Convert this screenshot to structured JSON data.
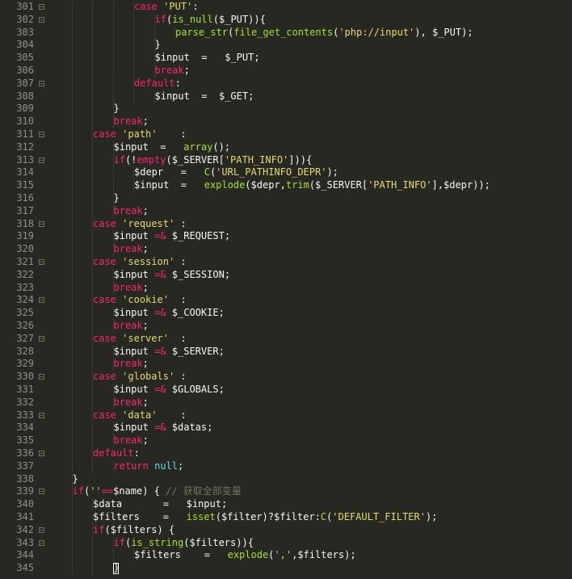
{
  "colors": {
    "background": "#272822",
    "line_number": "#8f908a",
    "keyword": "#f92672",
    "string": "#e6db74",
    "function": "#a6e22e",
    "text": "#f8f8f2",
    "comment": "#75715e",
    "constant": "#66d9ef"
  },
  "lines": [
    {
      "num": "301",
      "indent": 4,
      "fold": true,
      "tokens": [
        [
          "kw",
          "case"
        ],
        [
          "txt",
          " "
        ],
        [
          "str",
          "'PUT'"
        ],
        [
          "txt",
          ":"
        ]
      ]
    },
    {
      "num": "302",
      "indent": 5,
      "fold": true,
      "tokens": [
        [
          "kw",
          "if"
        ],
        [
          "txt",
          "("
        ],
        [
          "fn",
          "is_null"
        ],
        [
          "txt",
          "("
        ],
        [
          "var",
          "$_PUT"
        ],
        [
          "txt",
          "))"
        ],
        [
          "txt",
          "{"
        ]
      ]
    },
    {
      "num": "303",
      "indent": 6,
      "fold": false,
      "tokens": [
        [
          "fn",
          "parse_str"
        ],
        [
          "txt",
          "("
        ],
        [
          "fn",
          "file_get_contents"
        ],
        [
          "txt",
          "("
        ],
        [
          "str",
          "'php://input'"
        ],
        [
          "txt",
          "), "
        ],
        [
          "var",
          "$_PUT"
        ],
        [
          "txt",
          ");"
        ]
      ]
    },
    {
      "num": "304",
      "indent": 5,
      "fold": false,
      "tokens": [
        [
          "txt",
          "}"
        ]
      ]
    },
    {
      "num": "305",
      "indent": 5,
      "fold": false,
      "tokens": [
        [
          "var",
          "$input"
        ],
        [
          "txt",
          "  =   "
        ],
        [
          "var",
          "$_PUT"
        ],
        [
          "txt",
          ";"
        ]
      ]
    },
    {
      "num": "306",
      "indent": 5,
      "fold": false,
      "tokens": [
        [
          "kw",
          "break"
        ],
        [
          "txt",
          ";"
        ]
      ]
    },
    {
      "num": "307",
      "indent": 4,
      "fold": true,
      "tokens": [
        [
          "kw",
          "default"
        ],
        [
          "txt",
          ":"
        ]
      ]
    },
    {
      "num": "308",
      "indent": 5,
      "fold": false,
      "tokens": [
        [
          "var",
          "$input"
        ],
        [
          "txt",
          "  =  "
        ],
        [
          "var",
          "$_GET"
        ],
        [
          "txt",
          ";"
        ]
      ]
    },
    {
      "num": "309",
      "indent": 3,
      "fold": false,
      "tokens": [
        [
          "txt",
          "}"
        ]
      ]
    },
    {
      "num": "310",
      "indent": 3,
      "fold": false,
      "tokens": [
        [
          "kw",
          "break"
        ],
        [
          "txt",
          ";"
        ]
      ]
    },
    {
      "num": "311",
      "indent": 2,
      "fold": true,
      "tokens": [
        [
          "kw",
          "case"
        ],
        [
          "txt",
          " "
        ],
        [
          "str",
          "'path'"
        ],
        [
          "txt",
          "    :"
        ]
      ]
    },
    {
      "num": "312",
      "indent": 3,
      "fold": false,
      "tokens": [
        [
          "var",
          "$input"
        ],
        [
          "txt",
          "  =   "
        ],
        [
          "fn",
          "array"
        ],
        [
          "txt",
          "();"
        ]
      ]
    },
    {
      "num": "313",
      "indent": 3,
      "fold": true,
      "tokens": [
        [
          "kw",
          "if"
        ],
        [
          "txt",
          "(!"
        ],
        [
          "kw",
          "empty"
        ],
        [
          "txt",
          "("
        ],
        [
          "var",
          "$_SERVER"
        ],
        [
          "txt",
          "["
        ],
        [
          "str",
          "'PATH_INFO'"
        ],
        [
          "txt",
          "])){"
        ]
      ]
    },
    {
      "num": "314",
      "indent": 4,
      "fold": false,
      "tokens": [
        [
          "var",
          "$depr"
        ],
        [
          "txt",
          "   =   "
        ],
        [
          "fn",
          "C"
        ],
        [
          "txt",
          "("
        ],
        [
          "str",
          "'URL_PATHINFO_DEPR'"
        ],
        [
          "txt",
          ");"
        ]
      ]
    },
    {
      "num": "315",
      "indent": 4,
      "fold": false,
      "tokens": [
        [
          "var",
          "$input"
        ],
        [
          "txt",
          "  =   "
        ],
        [
          "fn",
          "explode"
        ],
        [
          "txt",
          "("
        ],
        [
          "var",
          "$depr"
        ],
        [
          "txt",
          ","
        ],
        [
          "fn",
          "trim"
        ],
        [
          "txt",
          "("
        ],
        [
          "var",
          "$_SERVER"
        ],
        [
          "txt",
          "["
        ],
        [
          "str",
          "'PATH_INFO'"
        ],
        [
          "txt",
          "],"
        ],
        [
          "var",
          "$depr"
        ],
        [
          "txt",
          "));"
        ]
      ]
    },
    {
      "num": "316",
      "indent": 3,
      "fold": false,
      "tokens": [
        [
          "txt",
          "}"
        ]
      ]
    },
    {
      "num": "317",
      "indent": 3,
      "fold": false,
      "tokens": [
        [
          "kw",
          "break"
        ],
        [
          "txt",
          ";"
        ]
      ]
    },
    {
      "num": "318",
      "indent": 2,
      "fold": true,
      "tokens": [
        [
          "kw",
          "case"
        ],
        [
          "txt",
          " "
        ],
        [
          "str",
          "'request'"
        ],
        [
          "txt",
          " :"
        ]
      ]
    },
    {
      "num": "319",
      "indent": 3,
      "fold": false,
      "tokens": [
        [
          "var",
          "$input"
        ],
        [
          "txt",
          " "
        ],
        [
          "kw",
          "=&"
        ],
        [
          "txt",
          " "
        ],
        [
          "var",
          "$_REQUEST"
        ],
        [
          "txt",
          ";"
        ]
      ]
    },
    {
      "num": "320",
      "indent": 3,
      "fold": false,
      "tokens": [
        [
          "kw",
          "break"
        ],
        [
          "txt",
          ";"
        ]
      ]
    },
    {
      "num": "321",
      "indent": 2,
      "fold": true,
      "tokens": [
        [
          "kw",
          "case"
        ],
        [
          "txt",
          " "
        ],
        [
          "str",
          "'session'"
        ],
        [
          "txt",
          " :"
        ]
      ]
    },
    {
      "num": "322",
      "indent": 3,
      "fold": false,
      "tokens": [
        [
          "var",
          "$input"
        ],
        [
          "txt",
          " "
        ],
        [
          "kw",
          "=&"
        ],
        [
          "txt",
          " "
        ],
        [
          "var",
          "$_SESSION"
        ],
        [
          "txt",
          ";"
        ]
      ]
    },
    {
      "num": "323",
      "indent": 3,
      "fold": false,
      "tokens": [
        [
          "kw",
          "break"
        ],
        [
          "txt",
          ";"
        ]
      ]
    },
    {
      "num": "324",
      "indent": 2,
      "fold": true,
      "tokens": [
        [
          "kw",
          "case"
        ],
        [
          "txt",
          " "
        ],
        [
          "str",
          "'cookie'"
        ],
        [
          "txt",
          "  :"
        ]
      ]
    },
    {
      "num": "325",
      "indent": 3,
      "fold": false,
      "tokens": [
        [
          "var",
          "$input"
        ],
        [
          "txt",
          " "
        ],
        [
          "kw",
          "=&"
        ],
        [
          "txt",
          " "
        ],
        [
          "var",
          "$_COOKIE"
        ],
        [
          "txt",
          ";"
        ]
      ]
    },
    {
      "num": "326",
      "indent": 3,
      "fold": false,
      "tokens": [
        [
          "kw",
          "break"
        ],
        [
          "txt",
          ";"
        ]
      ]
    },
    {
      "num": "327",
      "indent": 2,
      "fold": true,
      "tokens": [
        [
          "kw",
          "case"
        ],
        [
          "txt",
          " "
        ],
        [
          "str",
          "'server'"
        ],
        [
          "txt",
          "  :"
        ]
      ]
    },
    {
      "num": "328",
      "indent": 3,
      "fold": false,
      "tokens": [
        [
          "var",
          "$input"
        ],
        [
          "txt",
          " "
        ],
        [
          "kw",
          "=&"
        ],
        [
          "txt",
          " "
        ],
        [
          "var",
          "$_SERVER"
        ],
        [
          "txt",
          ";"
        ]
      ]
    },
    {
      "num": "329",
      "indent": 3,
      "fold": false,
      "tokens": [
        [
          "kw",
          "break"
        ],
        [
          "txt",
          ";"
        ]
      ]
    },
    {
      "num": "330",
      "indent": 2,
      "fold": true,
      "tokens": [
        [
          "kw",
          "case"
        ],
        [
          "txt",
          " "
        ],
        [
          "str",
          "'globals'"
        ],
        [
          "txt",
          " :"
        ]
      ]
    },
    {
      "num": "331",
      "indent": 3,
      "fold": false,
      "tokens": [
        [
          "var",
          "$input"
        ],
        [
          "txt",
          " "
        ],
        [
          "kw",
          "=&"
        ],
        [
          "txt",
          " "
        ],
        [
          "var",
          "$GLOBALS"
        ],
        [
          "txt",
          ";"
        ]
      ]
    },
    {
      "num": "332",
      "indent": 3,
      "fold": false,
      "tokens": [
        [
          "kw",
          "break"
        ],
        [
          "txt",
          ";"
        ]
      ]
    },
    {
      "num": "333",
      "indent": 2,
      "fold": true,
      "tokens": [
        [
          "kw",
          "case"
        ],
        [
          "txt",
          " "
        ],
        [
          "str",
          "'data'"
        ],
        [
          "txt",
          "    :"
        ]
      ]
    },
    {
      "num": "334",
      "indent": 3,
      "fold": false,
      "tokens": [
        [
          "var",
          "$input"
        ],
        [
          "txt",
          " "
        ],
        [
          "kw",
          "=&"
        ],
        [
          "txt",
          " "
        ],
        [
          "var",
          "$datas"
        ],
        [
          "txt",
          ";"
        ]
      ]
    },
    {
      "num": "335",
      "indent": 3,
      "fold": false,
      "tokens": [
        [
          "kw",
          "break"
        ],
        [
          "txt",
          ";"
        ]
      ]
    },
    {
      "num": "336",
      "indent": 2,
      "fold": true,
      "tokens": [
        [
          "kw",
          "default"
        ],
        [
          "txt",
          ":"
        ]
      ]
    },
    {
      "num": "337",
      "indent": 3,
      "fold": false,
      "tokens": [
        [
          "kw",
          "return"
        ],
        [
          "txt",
          " "
        ],
        [
          "const",
          "null"
        ],
        [
          "txt",
          ";"
        ]
      ]
    },
    {
      "num": "338",
      "indent": 1,
      "fold": false,
      "tokens": [
        [
          "txt",
          "}"
        ]
      ]
    },
    {
      "num": "339",
      "indent": 1,
      "fold": true,
      "tokens": [
        [
          "kw",
          "if"
        ],
        [
          "txt",
          "("
        ],
        [
          "str",
          "''"
        ],
        [
          "kw",
          "=="
        ],
        [
          "var",
          "$name"
        ],
        [
          "txt",
          ") { "
        ],
        [
          "com",
          "// 获取全部变量"
        ]
      ]
    },
    {
      "num": "340",
      "indent": 2,
      "fold": false,
      "tokens": [
        [
          "var",
          "$data"
        ],
        [
          "txt",
          "       =   "
        ],
        [
          "var",
          "$input"
        ],
        [
          "txt",
          ";"
        ]
      ]
    },
    {
      "num": "341",
      "indent": 2,
      "fold": false,
      "tokens": [
        [
          "var",
          "$filters"
        ],
        [
          "txt",
          "    =   "
        ],
        [
          "fn",
          "isset"
        ],
        [
          "txt",
          "("
        ],
        [
          "var",
          "$filter"
        ],
        [
          "txt",
          ")?"
        ],
        [
          "var",
          "$filter"
        ],
        [
          "txt",
          ":"
        ],
        [
          "fn",
          "C"
        ],
        [
          "txt",
          "("
        ],
        [
          "str",
          "'DEFAULT_FILTER'"
        ],
        [
          "txt",
          ");"
        ]
      ]
    },
    {
      "num": "342",
      "indent": 2,
      "fold": true,
      "tokens": [
        [
          "kw",
          "if"
        ],
        [
          "txt",
          "("
        ],
        [
          "var",
          "$filters"
        ],
        [
          "txt",
          ") {"
        ]
      ]
    },
    {
      "num": "343",
      "indent": 3,
      "fold": true,
      "tokens": [
        [
          "kw",
          "if"
        ],
        [
          "txt",
          "("
        ],
        [
          "fn",
          "is_string"
        ],
        [
          "txt",
          "("
        ],
        [
          "var",
          "$filters"
        ],
        [
          "txt",
          "))"
        ],
        [
          "txt",
          "{"
        ]
      ]
    },
    {
      "num": "344",
      "indent": 4,
      "fold": false,
      "tokens": [
        [
          "var",
          "$filters"
        ],
        [
          "txt",
          "    =   "
        ],
        [
          "fn",
          "explode"
        ],
        [
          "txt",
          "("
        ],
        [
          "str",
          "','"
        ],
        [
          "txt",
          ","
        ],
        [
          "var",
          "$filters"
        ],
        [
          "txt",
          ");"
        ]
      ]
    },
    {
      "num": "345",
      "indent": 3,
      "fold": false,
      "cursor": true,
      "tokens": [
        [
          "txt",
          "}"
        ]
      ]
    }
  ]
}
